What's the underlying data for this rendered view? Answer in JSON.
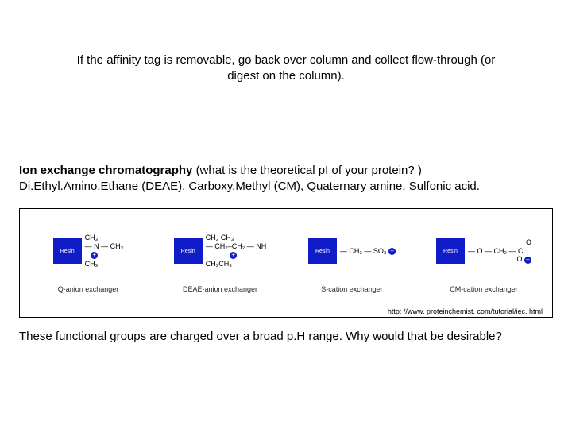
{
  "intro": "If the affinity tag is removable, go back over column and collect flow-through (or digest on the column).",
  "iec": {
    "title": "Ion exchange chromatography",
    "title_paren": "(what is the theoretical pI of your protein? )",
    "subline": "Di.Ethyl.Amino.Ethane (DEAE), Carboxy.Methyl (CM), Quaternary amine, Sulfonic acid."
  },
  "exchangers": [
    {
      "resin": "Resin",
      "label": "Q-anion exchanger"
    },
    {
      "resin": "Resin",
      "label": "DEAE-anion exchanger"
    },
    {
      "resin": "Resin",
      "label": "S-cation exchanger"
    },
    {
      "resin": "Resin",
      "label": "CM-cation exchanger"
    }
  ],
  "structures": {
    "q_top": "CH₃",
    "q_mid": "— N — CH₃",
    "q_bot": "CH₃",
    "deae_top": "CH₂ CH₃",
    "deae_mid": "— CH₂–CH₂ — NH",
    "deae_bot": "CH₂CH₃",
    "s": "— CH₂ — SO₃",
    "cm_top": "O",
    "cm_mid": "— O — CH₂ — C",
    "cm_bot": "O"
  },
  "charge_plus": "+",
  "charge_minus": "–",
  "source": "http: //www. proteinchemist. com/tutorial/iec. html",
  "footer": "These functional groups are charged over a broad p.H range. Why would that be desirable?"
}
